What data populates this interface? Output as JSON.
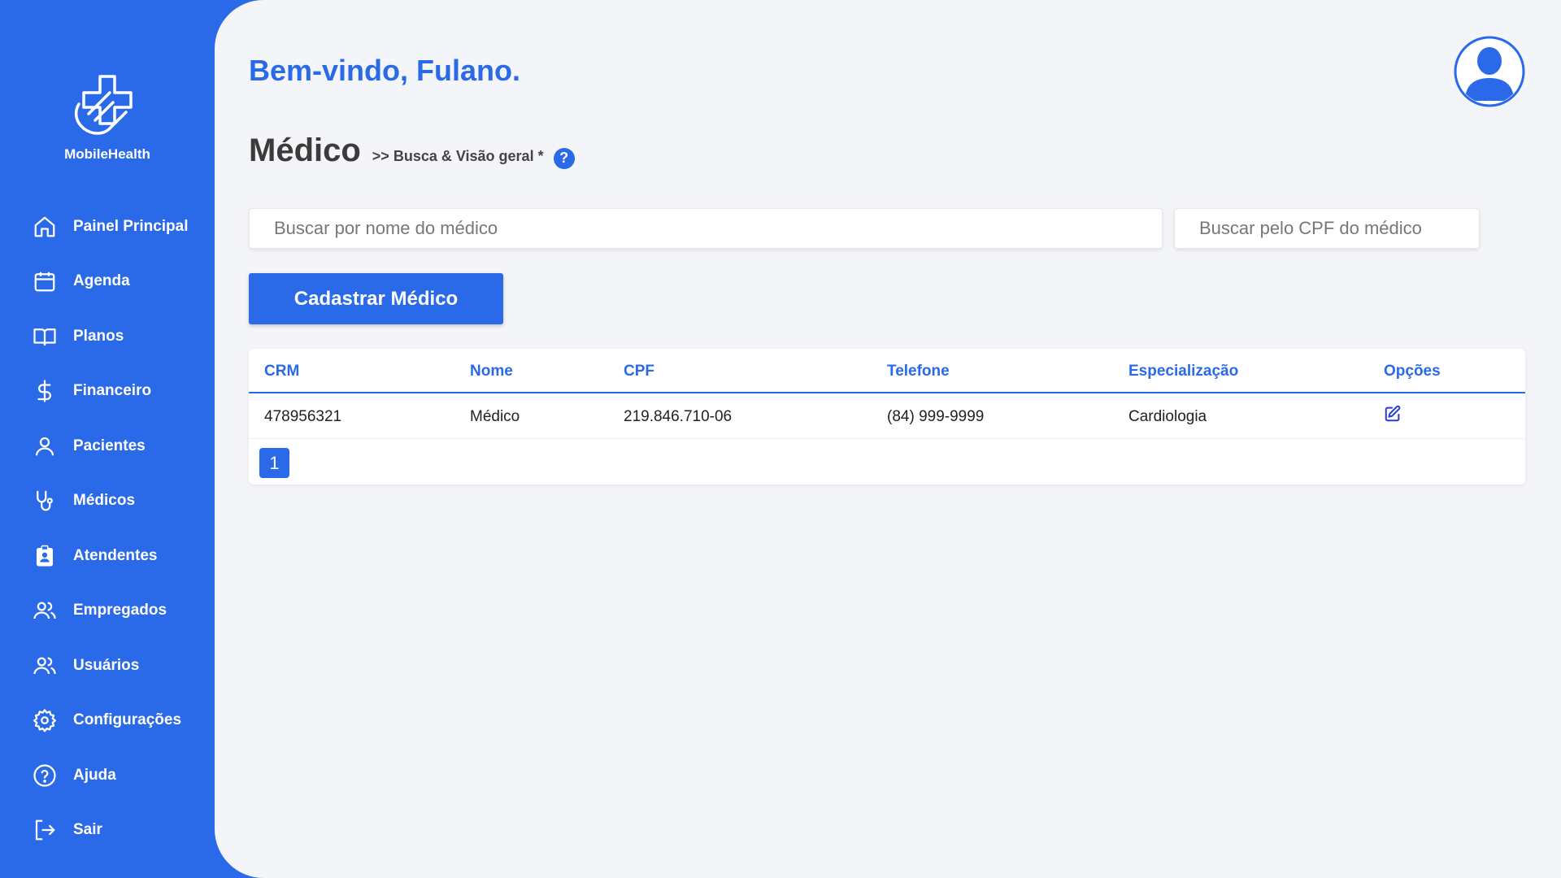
{
  "app": {
    "name": "MobileHealth"
  },
  "colors": {
    "accent": "#2a6ae9",
    "background": "#f4f5f8"
  },
  "sidebar": {
    "items": [
      {
        "label": "Painel Principal",
        "icon": "home-icon"
      },
      {
        "label": "Agenda",
        "icon": "calendar-icon"
      },
      {
        "label": "Planos",
        "icon": "book-icon"
      },
      {
        "label": "Financeiro",
        "icon": "dollar-icon"
      },
      {
        "label": "Pacientes",
        "icon": "user-icon"
      },
      {
        "label": "Médicos",
        "icon": "stethoscope-icon"
      },
      {
        "label": "Atendentes",
        "icon": "badge-icon"
      },
      {
        "label": "Empregados",
        "icon": "users-icon"
      },
      {
        "label": "Usuários",
        "icon": "users-icon"
      },
      {
        "label": "Configurações",
        "icon": "gear-icon"
      },
      {
        "label": "Ajuda",
        "icon": "help-circle-icon"
      },
      {
        "label": "Sair",
        "icon": "logout-icon"
      }
    ]
  },
  "header": {
    "welcome": "Bem-vindo, Fulano.",
    "title": "Médico",
    "breadcrumb": ">> Busca & Visão geral *",
    "help": "?"
  },
  "search": {
    "name_placeholder": "Buscar por nome do médico",
    "cpf_placeholder": "Buscar pelo CPF do médico"
  },
  "actions": {
    "create_label": "Cadastrar Médico"
  },
  "table": {
    "columns": [
      "CRM",
      "Nome",
      "CPF",
      "Telefone",
      "Especialização",
      "Opções"
    ],
    "rows": [
      {
        "crm": "478956321",
        "nome": "Médico",
        "cpf": "219.846.710-06",
        "telefone": "(84) 999-9999",
        "especializacao": "Cardiologia"
      }
    ]
  },
  "pagination": {
    "current": "1"
  }
}
